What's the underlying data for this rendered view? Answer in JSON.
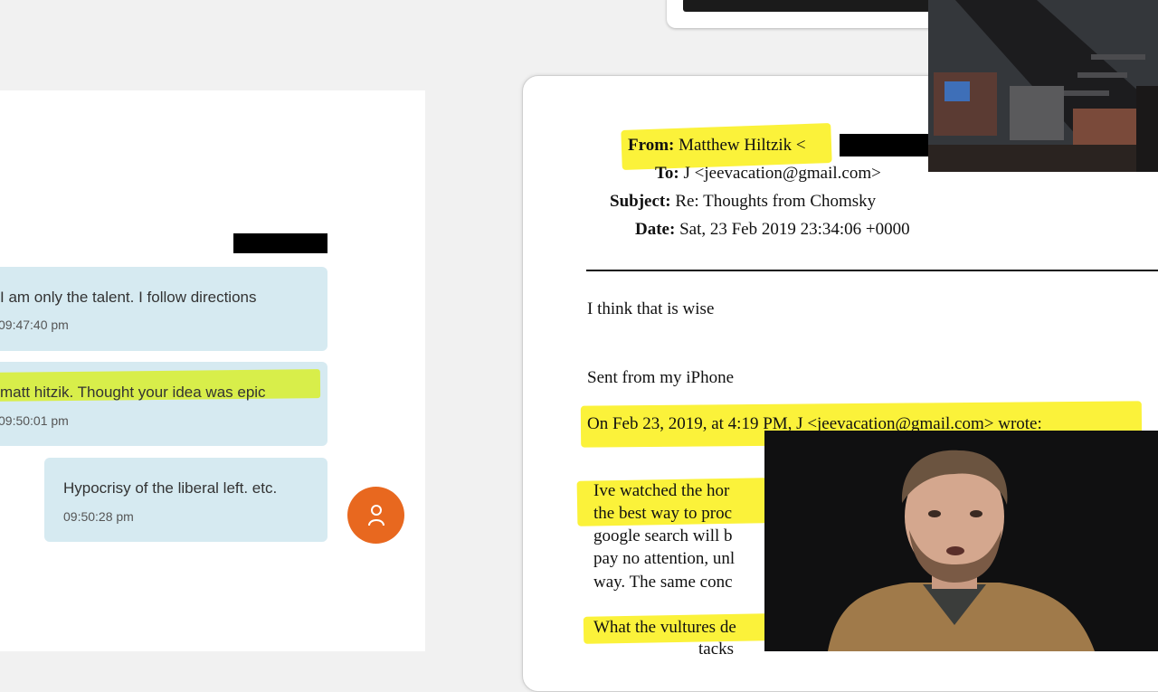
{
  "chat": {
    "messages": [
      {
        "text": "I am only the talent.    I follow directions",
        "time": "09:47:40 pm"
      },
      {
        "text": "matt hitzik.   Thought your idea was epic",
        "time": "09:50:01 pm"
      },
      {
        "text": "Hypocrisy of the liberal left. etc.",
        "time": "09:50:28 pm"
      }
    ],
    "avatar_icon": "person-icon"
  },
  "email": {
    "from_label": "From:",
    "from_value": "Matthew Hiltzik <",
    "to_label": "To:",
    "to_value": "J <jeevacation@gmail.com>",
    "subject_label": "Subject:",
    "subject_value": "Re: Thoughts from Chomsky",
    "date_label": "Date:",
    "date_value": "Sat, 23 Feb 2019 23:34:06 +0000",
    "body": [
      "I think that is wise",
      "Sent from my iPhone",
      "On Feb 23, 2019, at 4:19 PM, J <jeevacation@gmail.com> wrote:",
      "Ive watched  the hor",
      "the best way to proc",
      "google search will b",
      "pay no attention, unl",
      "way.  The same conc",
      "What the vultures de",
      "tacks"
    ]
  },
  "colors": {
    "chat_bubble": "#d6eaf1",
    "highlight_green": "#d8ee4a",
    "highlight_yellow": "#fbf23a",
    "avatar": "#e8681f"
  }
}
